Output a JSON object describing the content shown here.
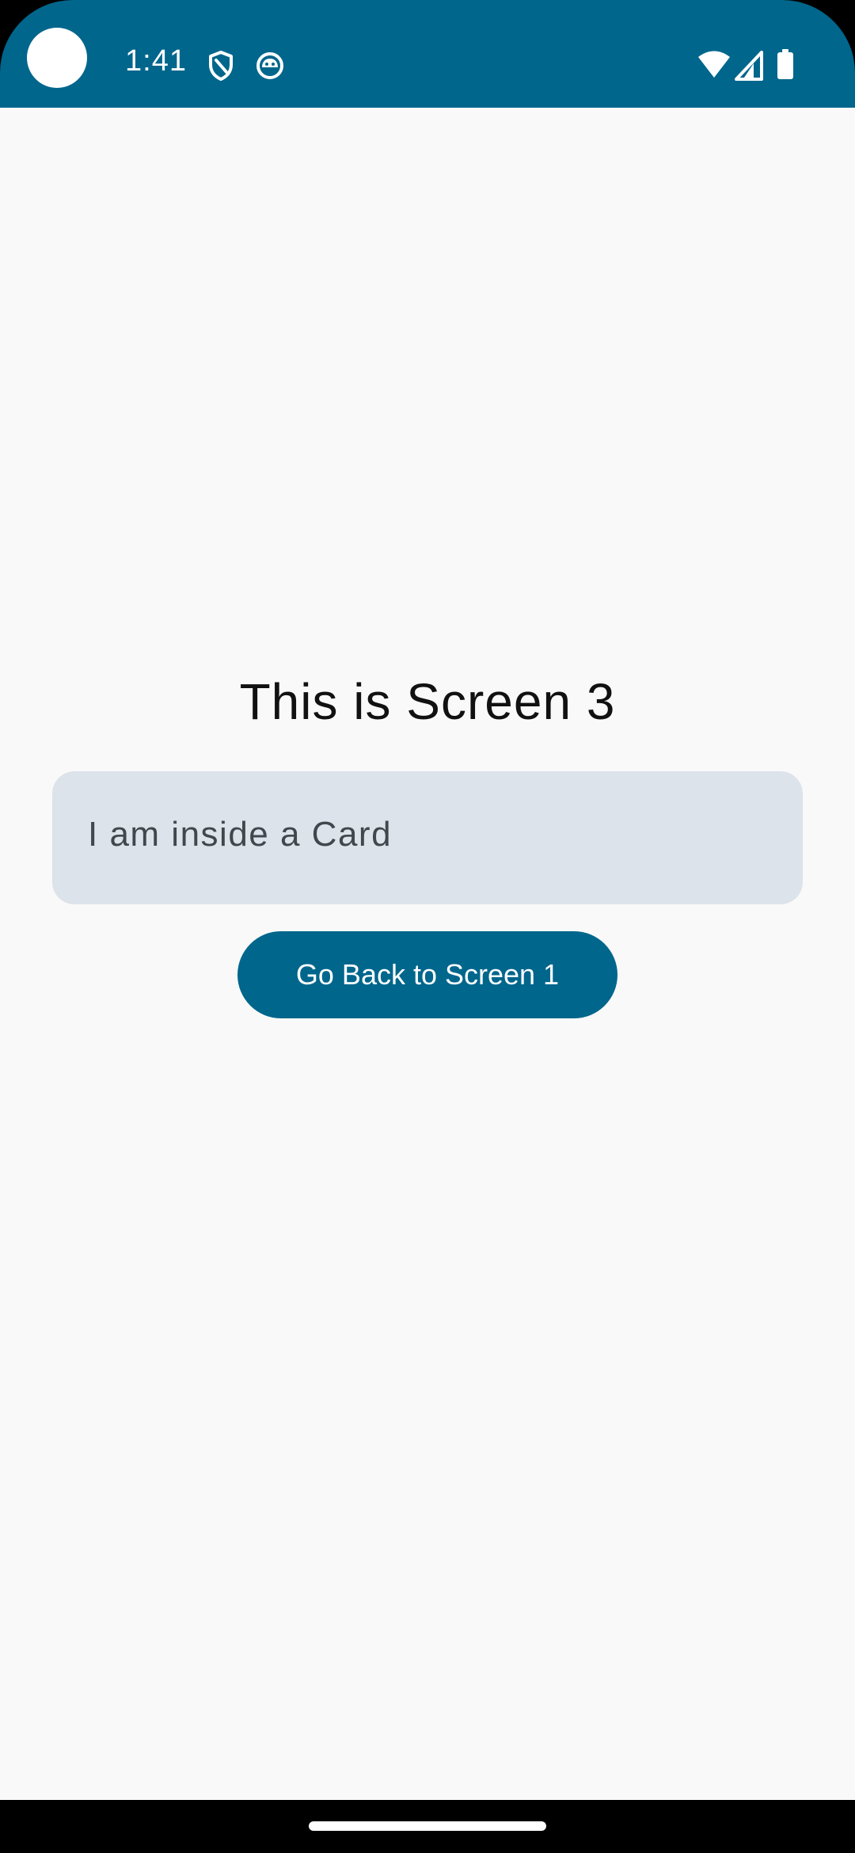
{
  "status_bar": {
    "time": "1:41",
    "background_color": "#00668c",
    "left_icons": [
      "camera-cutout",
      "shield-icon",
      "android-debug-icon"
    ],
    "right_icons": [
      "wifi-icon",
      "cell-signal-icon",
      "battery-icon"
    ]
  },
  "main": {
    "title": "This is Screen 3",
    "card": {
      "text": "I am inside a Card",
      "background_color": "#dde3ea"
    },
    "back_button": {
      "label": "Go Back to Screen 1",
      "background_color": "#00668c"
    }
  },
  "navigation": {
    "gesture_handle": "home-gesture-handle"
  }
}
